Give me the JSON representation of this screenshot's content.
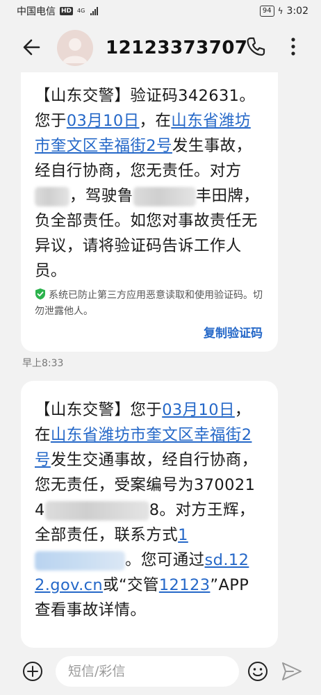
{
  "status_bar": {
    "carrier": "中国电信",
    "hd": "HD",
    "network": "4G",
    "battery": "94",
    "time": "3:02"
  },
  "header": {
    "contact": "12123373707",
    "back_icon": "back-arrow-icon",
    "phone_icon": "phone-icon",
    "more_icon": "more-vertical-icon"
  },
  "messages": [
    {
      "parts": {
        "p1": "【山东交警】验证码342631。您于",
        "date_link": "03月10日",
        "p2": "，在",
        "addr_link": "山东省潍坊市奎文区幸福街2号",
        "p3": "发生事故，经自行协商，您无责任。对方",
        "p4": "，驾驶鲁",
        "p5": "丰田牌，负全部责任。如您对事故责任无异议，请将验证码告诉工作人员。"
      },
      "security_note": "系统已防止第三方应用恶意读取和使用验证码。切勿泄露他人。",
      "copy_label": "复制验证码",
      "time": "早上8:33"
    },
    {
      "parts": {
        "p1": "【山东交警】您于",
        "date_link": "03月10日",
        "p2": "，在",
        "addr_link": "山东省潍坊市奎文区幸福街2号",
        "p3": "发生交通事故，经自行协商，您无责任，受案编号为3700214",
        "p4": "8。对方王辉，全部责任，联系方式",
        "phone_start": "1",
        "p5": "。您可通过",
        "site_link": "sd.122.gov.cn",
        "p6": "或“交管",
        "app_link": "12123",
        "p7": "”APP查看事故详情。"
      }
    }
  ],
  "input_bar": {
    "placeholder": "短信/彩信",
    "add_icon": "add-icon",
    "emoji_icon": "emoji-icon",
    "send_icon": "send-icon"
  },
  "colors": {
    "link": "#2568c8",
    "background": "#f2f2f2",
    "bubble": "#ffffff",
    "shield": "#2bb24c"
  }
}
